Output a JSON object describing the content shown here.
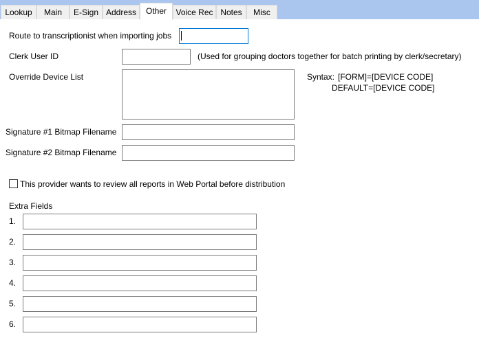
{
  "tabs": [
    {
      "id": "lookup",
      "label": "Lookup"
    },
    {
      "id": "main",
      "label": "Main"
    },
    {
      "id": "esign",
      "label": "E-Sign"
    },
    {
      "id": "address",
      "label": "Address"
    },
    {
      "id": "other",
      "label": "Other",
      "active": true
    },
    {
      "id": "voicerec",
      "label": "Voice Rec"
    },
    {
      "id": "notes",
      "label": "Notes"
    },
    {
      "id": "misc",
      "label": "Misc"
    }
  ],
  "form": {
    "route_label": "Route to transcriptionist when importing jobs",
    "route_value": "",
    "clerk_label": "Clerk User ID",
    "clerk_value": "",
    "clerk_hint": "(Used for grouping doctors together for batch printing by clerk/secretary)",
    "override_label": "Override Device List",
    "override_value": "",
    "syntax_label": "Syntax:",
    "syntax_line1": "[FORM]=[DEVICE CODE]",
    "syntax_line2": "DEFAULT=[DEVICE CODE]",
    "sig1_label": "Signature #1 Bitmap Filename",
    "sig1_value": "",
    "sig2_label": "Signature #2 Bitmap Filename",
    "sig2_value": "",
    "review_label": "This provider wants to review all reports in Web Portal before distribution",
    "review_checked": false,
    "extra_label": "Extra Fields",
    "extra_fields": [
      {
        "num": "1.",
        "value": ""
      },
      {
        "num": "2.",
        "value": ""
      },
      {
        "num": "3.",
        "value": ""
      },
      {
        "num": "4.",
        "value": ""
      },
      {
        "num": "5.",
        "value": ""
      },
      {
        "num": "6.",
        "value": ""
      }
    ]
  }
}
